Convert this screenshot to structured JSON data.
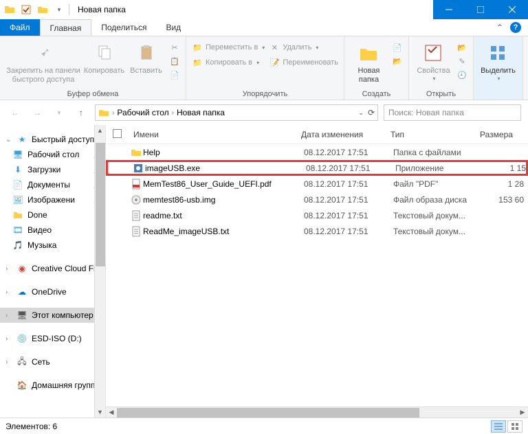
{
  "window": {
    "title": "Новая папка"
  },
  "tabs": {
    "file": "Файл",
    "home": "Главная",
    "share": "Поделиться",
    "view": "Вид"
  },
  "ribbon": {
    "pin": "Закрепить на панели быстрого доступа",
    "copy": "Копировать",
    "paste": "Вставить",
    "move_to": "Переместить в",
    "copy_to": "Копировать в",
    "delete": "Удалить",
    "rename": "Переименовать",
    "new_folder": "Новая папка",
    "properties": "Свойства",
    "select": "Выделить",
    "group_clipboard": "Буфер обмена",
    "group_organize": "Упорядочить",
    "group_new": "Создать",
    "group_open": "Открыть",
    "group_select": "",
    "scissors": "",
    "copypath": "",
    "pasteshortcut": ""
  },
  "breadcrumb": {
    "a": "Рабочий стол",
    "b": "Новая папка"
  },
  "search": {
    "placeholder": "Поиск: Новая папка"
  },
  "columns": {
    "name": "Имени",
    "date": "Дата изменения",
    "type": "Тип",
    "size": "Размера"
  },
  "sidebar": {
    "quick": "Быстрый доступ",
    "desktop": "Рабочий стол",
    "downloads": "Загрузки",
    "documents": "Документы",
    "pictures": "Изображени",
    "done": "Done",
    "videos": "Видео",
    "music": "Музыка",
    "ccf": "Creative Cloud Fil",
    "onedrive": "OneDrive",
    "thispc": "Этот компьютер",
    "esd": "ESD-ISO (D:)",
    "network": "Сеть",
    "homegroup": "Домашняя групп"
  },
  "files": [
    {
      "name": "Help",
      "date": "08.12.2017 17:51",
      "type": "Папка с файлами",
      "size": "",
      "icon": "folder"
    },
    {
      "name": "imageUSB.exe",
      "date": "08.12.2017 17:51",
      "type": "Приложение",
      "size": "1 15",
      "icon": "exe"
    },
    {
      "name": "MemTest86_User_Guide_UEFI.pdf",
      "date": "08.12.2017 17:51",
      "type": "Файл \"PDF\"",
      "size": "1 28",
      "icon": "pdf"
    },
    {
      "name": "memtest86-usb.img",
      "date": "08.12.2017 17:51",
      "type": "Файл образа диска",
      "size": "153 60",
      "icon": "img"
    },
    {
      "name": "readme.txt",
      "date": "08.12.2017 17:51",
      "type": "Текстовый докум...",
      "size": "",
      "icon": "txt"
    },
    {
      "name": "ReadMe_imageUSB.txt",
      "date": "08.12.2017 17:51",
      "type": "Текстовый докум...",
      "size": "",
      "icon": "txt"
    }
  ],
  "status": {
    "count": "Элементов: 6"
  }
}
